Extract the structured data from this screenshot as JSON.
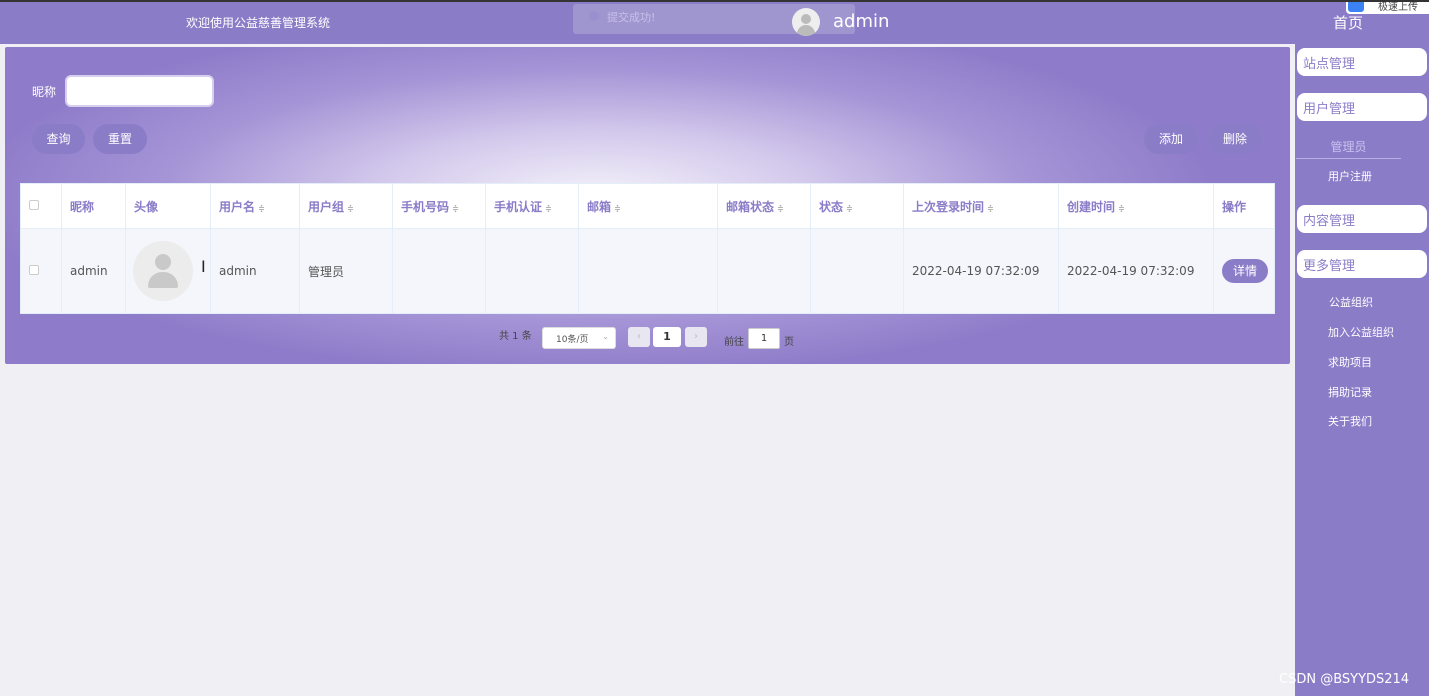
{
  "header": {
    "site_title": "欢迎使用公益慈善管理系统",
    "toast_text": "提交成功!",
    "user_name": "admin",
    "home_link": "首页",
    "corner_badge": "极速上传"
  },
  "search": {
    "label": "昵称",
    "value": "",
    "query_button": "查询",
    "reset_button": "重置",
    "add_button": "添加",
    "delete_button": "删除"
  },
  "table": {
    "columns": [
      "昵称",
      "头像",
      "用户名",
      "用户组",
      "手机号码",
      "手机认证",
      "邮箱",
      "邮箱状态",
      "状态",
      "上次登录时间",
      "创建时间",
      "操作"
    ],
    "rows": [
      {
        "nickname": "admin",
        "username": "admin",
        "group": "管理员",
        "phone": "",
        "phone_verified": "",
        "email": "",
        "email_status": "",
        "status": "",
        "last_login": "2022-04-19 07:32:09",
        "created": "2022-04-19 07:32:09",
        "action": "详情"
      }
    ]
  },
  "pagination": {
    "total": "共 1 条",
    "page_size": "10条/页",
    "current_page": "1",
    "goto_prefix": "前往",
    "goto_value": "1",
    "goto_suffix": "页"
  },
  "sidebar": {
    "site_mgmt": "站点管理",
    "user_mgmt": "用户管理",
    "user_sub": [
      "管理员",
      "用户注册"
    ],
    "content_mgmt": "内容管理",
    "more_mgmt": "更多管理",
    "more_sub": [
      "公益组织",
      "加入公益组织",
      "求助项目",
      "捐助记录",
      "关于我们"
    ]
  },
  "watermark": "CSDN @BSYYDS214",
  "colors": {
    "accent": "#8b7cc8",
    "header_text": "#ffffff"
  }
}
